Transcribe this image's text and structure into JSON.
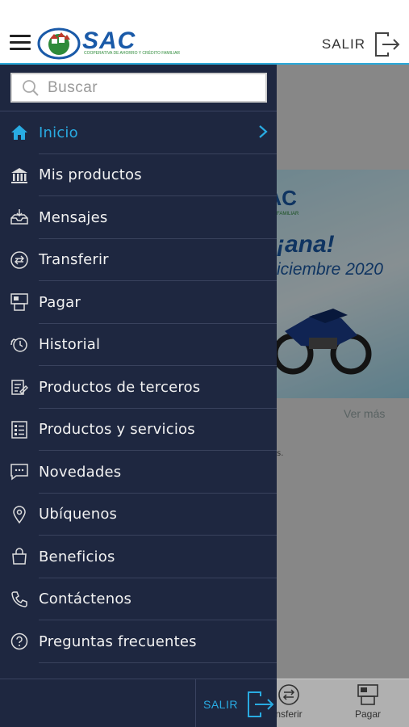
{
  "header": {
    "logo_text": "SAC",
    "logo_subtitle": "COOPERATIVA DE AHORRO Y CRÉDITO FAMILIAR",
    "salir_label": "SALIR"
  },
  "main": {
    "banner_brand": "SAC",
    "banner_brand_sub": "FAMILIAR",
    "banner_line1": "¡ana!",
    "banner_line2": "iciembre 2020",
    "ver_mas": "Ver más",
    "dot_text": "s."
  },
  "drawer": {
    "search_placeholder": "Buscar",
    "items": [
      {
        "label": "Inicio",
        "icon": "home-icon",
        "active": true
      },
      {
        "label": "Mis productos",
        "icon": "bank-icon",
        "active": false
      },
      {
        "label": "Mensajes",
        "icon": "inbox-icon",
        "active": false
      },
      {
        "label": "Transferir",
        "icon": "transfer-icon",
        "active": false
      },
      {
        "label": "Pagar",
        "icon": "pay-icon",
        "active": false
      },
      {
        "label": "Historial",
        "icon": "history-icon",
        "active": false
      },
      {
        "label": "Productos de terceros",
        "icon": "third-party-icon",
        "active": false
      },
      {
        "label": "Productos y servicios",
        "icon": "services-icon",
        "active": false
      },
      {
        "label": "Novedades",
        "icon": "news-icon",
        "active": false
      },
      {
        "label": "Ubíquenos",
        "icon": "location-icon",
        "active": false
      },
      {
        "label": "Beneficios",
        "icon": "benefits-icon",
        "active": false
      },
      {
        "label": "Contáctenos",
        "icon": "phone-icon",
        "active": false
      },
      {
        "label": "Preguntas frecuentes",
        "icon": "help-icon",
        "active": false
      }
    ],
    "footer_salir_label": "SALIR"
  },
  "tabbar": {
    "tabs": [
      {
        "label": "nsferir",
        "icon": "transfer-icon"
      },
      {
        "label": "Pagar",
        "icon": "pay-icon"
      }
    ]
  },
  "colors": {
    "drawer_bg": "#1e2740",
    "accent": "#29abe2",
    "brand_blue": "#1a5aa8"
  }
}
